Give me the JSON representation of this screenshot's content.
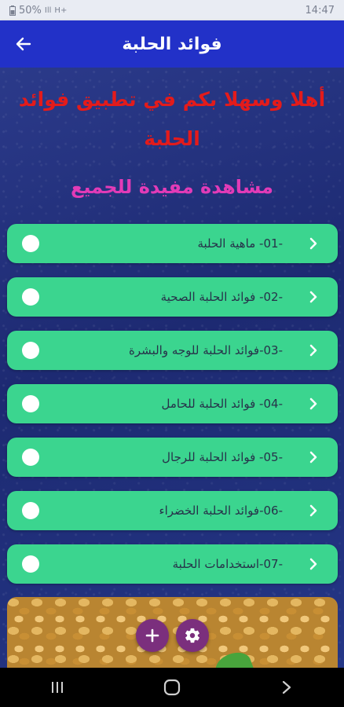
{
  "status_bar": {
    "battery": "50%",
    "signal_text": "Ill",
    "network_text": "H+",
    "time": "14:47"
  },
  "app_bar": {
    "title": "فوائد الحلبة",
    "back_icon": "arrow-left-icon"
  },
  "welcome_text": "أهلا وسهلا بكم في تطبيق فوائد الحلبة",
  "subtitle": "مشاهدة مفيدة للجميع",
  "menu": {
    "items": [
      {
        "label": "-01- ماهية الحلبة"
      },
      {
        "label": "-02- فوائد الحلبة الصحية"
      },
      {
        "label": "-03-فوائد الحلبة للوجه والبشرة"
      },
      {
        "label": "-04- فوائد الحلبة للحامل"
      },
      {
        "label": "-05- فوائد الحلبة للرجال"
      },
      {
        "label": "-06-فوائد الحلبة الخضراء"
      },
      {
        "label": "-07-استخدامات الحلبة"
      }
    ]
  },
  "fabs": {
    "add_icon": "plus-icon",
    "settings_icon": "gear-icon"
  },
  "nav": {
    "recent_icon": "recent-apps-icon",
    "home_icon": "home-icon",
    "back_icon": "back-chevron-icon"
  },
  "colors": {
    "app_bar": "#2231c8",
    "menu_item": "#3bd58f",
    "welcome": "#e31b1b",
    "subtitle": "#e23bb7",
    "fab": "#7b2f7d"
  }
}
